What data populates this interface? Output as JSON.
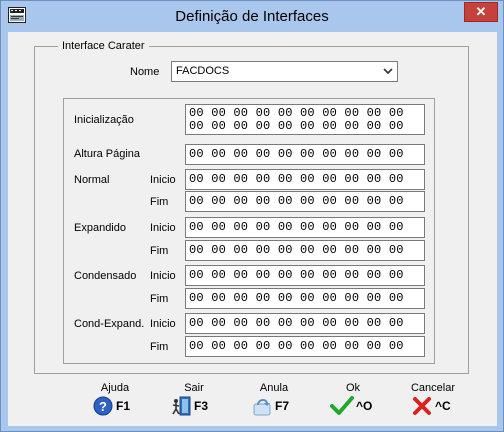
{
  "window": {
    "title": "Definição de Interfaces",
    "close_glyph": "✕"
  },
  "group": {
    "legend": "Interface Carater",
    "nome_label": "Nome",
    "nome_value": "FACDOCS"
  },
  "fields": {
    "inicializacao_label": "Inicialização",
    "inicializacao_line1": "00 00 00 00 00 00 00 00 00 00",
    "inicializacao_line2": "00 00 00 00 00 00 00 00 00 00",
    "altura_label": "Altura Página",
    "altura_value": "00 00 00 00 00 00 00 00 00 00",
    "normal_label": "Normal",
    "expandido_label": "Expandido",
    "condensado_label": "Condensado",
    "condexp_label": "Cond-Expand.",
    "inicio_label": "Inicio",
    "fim_label": "Fim",
    "normal_inicio": "00 00 00 00 00 00 00 00 00 00",
    "normal_fim": "00 00 00 00 00 00 00 00 00 00",
    "expandido_inicio": "00 00 00 00 00 00 00 00 00 00",
    "expandido_fim": "00 00 00 00 00 00 00 00 00 00",
    "condensado_inicio": "00 00 00 00 00 00 00 00 00 00",
    "condensado_fim": "00 00 00 00 00 00 00 00 00 00",
    "condexp_inicio": "00 00 00 00 00 00 00 00 00 00",
    "condexp_fim": "00 00 00 00 00 00 00 00 00 00"
  },
  "toolbar": {
    "ajuda_label": "Ajuda",
    "ajuda_key": "F1",
    "sair_label": "Sair",
    "sair_key": "F3",
    "anula_label": "Anula",
    "anula_key": "F7",
    "ok_label": "Ok",
    "ok_key": "^O",
    "cancelar_label": "Cancelar",
    "cancelar_key": "^C"
  },
  "colors": {
    "frame": "#a9c6ed",
    "client": "#f0f0f0",
    "close": "#c7413c",
    "ok_check": "#1faa2c",
    "cancel_x": "#d8231f",
    "help": "#2b62c4"
  },
  "icons": [
    "app-icon",
    "close-icon",
    "chevron-down-icon",
    "help-icon",
    "exit-door-icon",
    "undo-icon",
    "check-icon",
    "cancel-x-icon"
  ]
}
